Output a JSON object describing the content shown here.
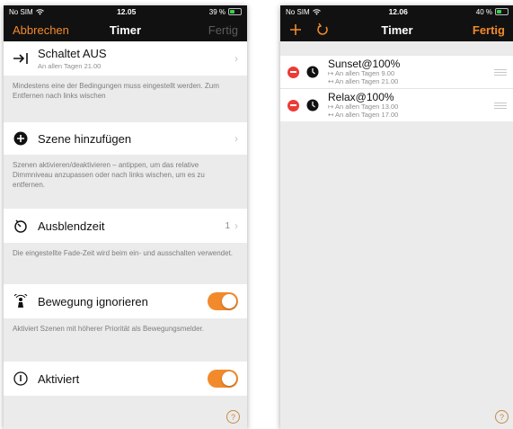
{
  "colors": {
    "accent": "#f28a2c",
    "delete": "#ec3b36",
    "toggle_on": "#f28a2c"
  },
  "left": {
    "status": {
      "carrier": "No SIM",
      "time": "12.05",
      "battery": "39 %"
    },
    "nav": {
      "cancel": "Abbrechen",
      "title": "Timer",
      "done": "Fertig"
    },
    "switch_off": {
      "title": "Schaltet AUS",
      "sub": "An allen Tagen  21.00",
      "icon": "arrow-to-bar-icon"
    },
    "hint_conditions": "Mindestens eine der Bedingungen muss eingestellt werden. Zum Entfernen nach links wischen",
    "add_scene": {
      "title": "Szene hinzufügen",
      "icon": "plus-circle-icon"
    },
    "hint_scenes": "Szenen aktivieren/deaktivieren – antippen, um das relative Dimmniveau anzupassen oder nach links wischen, um es zu entfernen.",
    "fade": {
      "title": "Ausblendzeit",
      "value": "1",
      "icon": "timer-icon"
    },
    "hint_fade": "Die eingestellte Fade-Zeit wird beim ein- und ausschalten verwendet.",
    "ignore_motion": {
      "title": "Bewegung ignorieren",
      "on": true,
      "icon": "motion-person-icon"
    },
    "hint_motion": "Aktiviert Szenen mit höherer Priorität als Bewegungsmelder.",
    "activated": {
      "title": "Aktiviert",
      "on": true,
      "icon": "power-icon"
    },
    "help": "?"
  },
  "right": {
    "status": {
      "carrier": "No SIM",
      "time": "12.06",
      "battery": "40 %"
    },
    "nav": {
      "title": "Timer",
      "done": "Fertig",
      "add_icon": "plus-icon",
      "refresh_icon": "refresh-icon"
    },
    "timers": [
      {
        "name": "Sunset@100%",
        "line1": "↦ An allen Tagen 9.00",
        "line2": "↤ An allen Tagen 21.00"
      },
      {
        "name": "Relax@100%",
        "line1": "↦ An allen Tagen 13.00",
        "line2": "↤ An allen Tagen 17.00"
      }
    ],
    "help": "?"
  }
}
